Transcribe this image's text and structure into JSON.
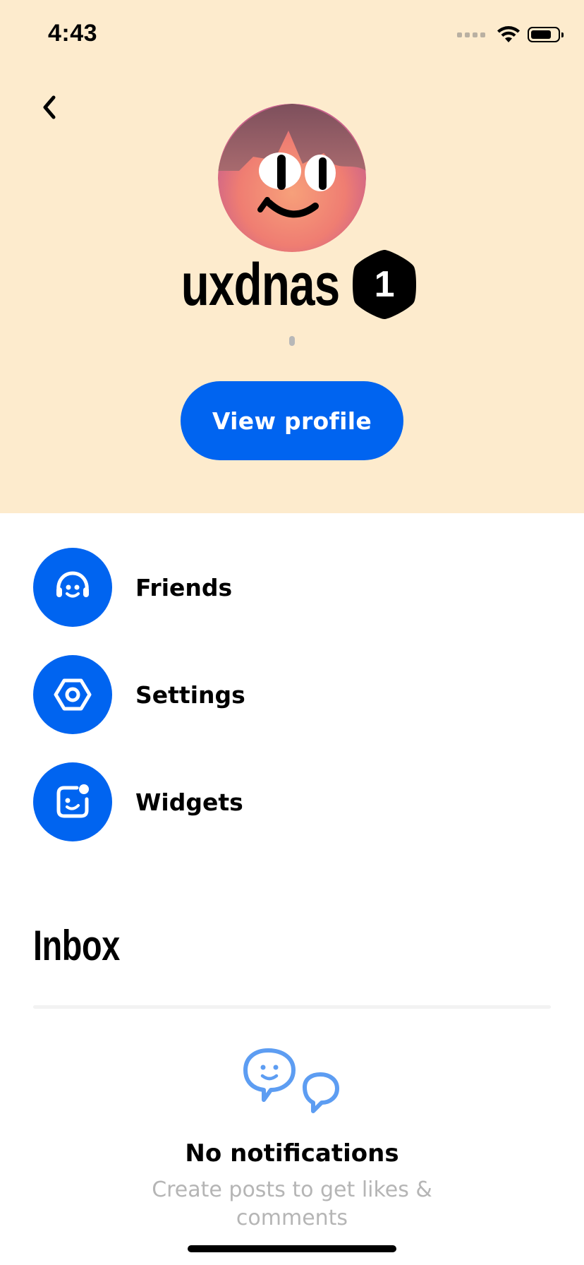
{
  "status_bar": {
    "time": "4:43",
    "icons": [
      "cellular-signal-icon",
      "wifi-icon",
      "battery-icon"
    ]
  },
  "header": {
    "background_color": "#fdebcd",
    "back_icon": "chevron-left-icon",
    "username": "uxdnas",
    "level": "1",
    "view_profile_label": "View profile"
  },
  "menu": {
    "items": [
      {
        "label": "Friends",
        "icon": "friends-icon"
      },
      {
        "label": "Settings",
        "icon": "settings-icon"
      },
      {
        "label": "Widgets",
        "icon": "widgets-icon"
      }
    ]
  },
  "inbox": {
    "title": "Inbox",
    "empty_title": "No notifications",
    "empty_subtitle": "Create posts to get likes & comments",
    "empty_icon": "chat-bubbles-icon"
  },
  "colors": {
    "accent": "#0064f0",
    "header_bg": "#fdebcd",
    "muted_text": "#b5b5b5"
  }
}
